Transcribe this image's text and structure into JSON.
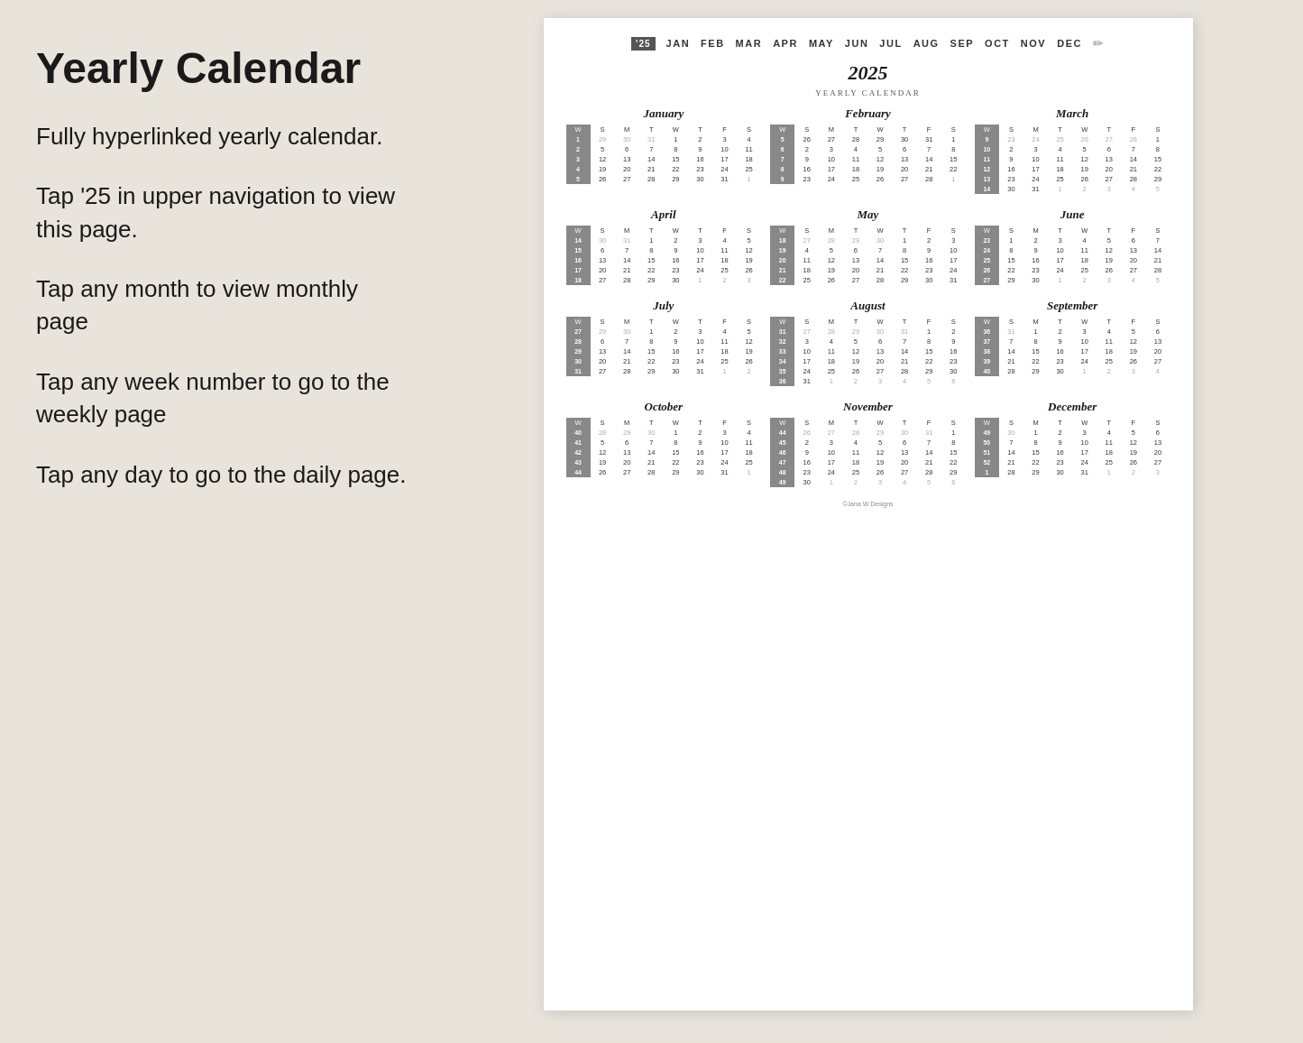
{
  "left": {
    "title": "Yearly Calendar",
    "descriptions": [
      "Fully hyperlinked yearly calendar.",
      "Tap '25 in upper navigation to view this page.",
      "Tap any month to view monthly page",
      "Tap any week number to go to the weekly page",
      "Tap any day to go to the daily page."
    ]
  },
  "calendar": {
    "year": "2025",
    "subtitle": "Yearly Calendar",
    "nav": {
      "badge": "'25",
      "months": [
        "JAN",
        "FEB",
        "MAR",
        "APR",
        "MAY",
        "JUN",
        "JUL",
        "AUG",
        "SEP",
        "OCT",
        "NOV",
        "DEC"
      ]
    },
    "footer": "©Jana W Designs"
  }
}
